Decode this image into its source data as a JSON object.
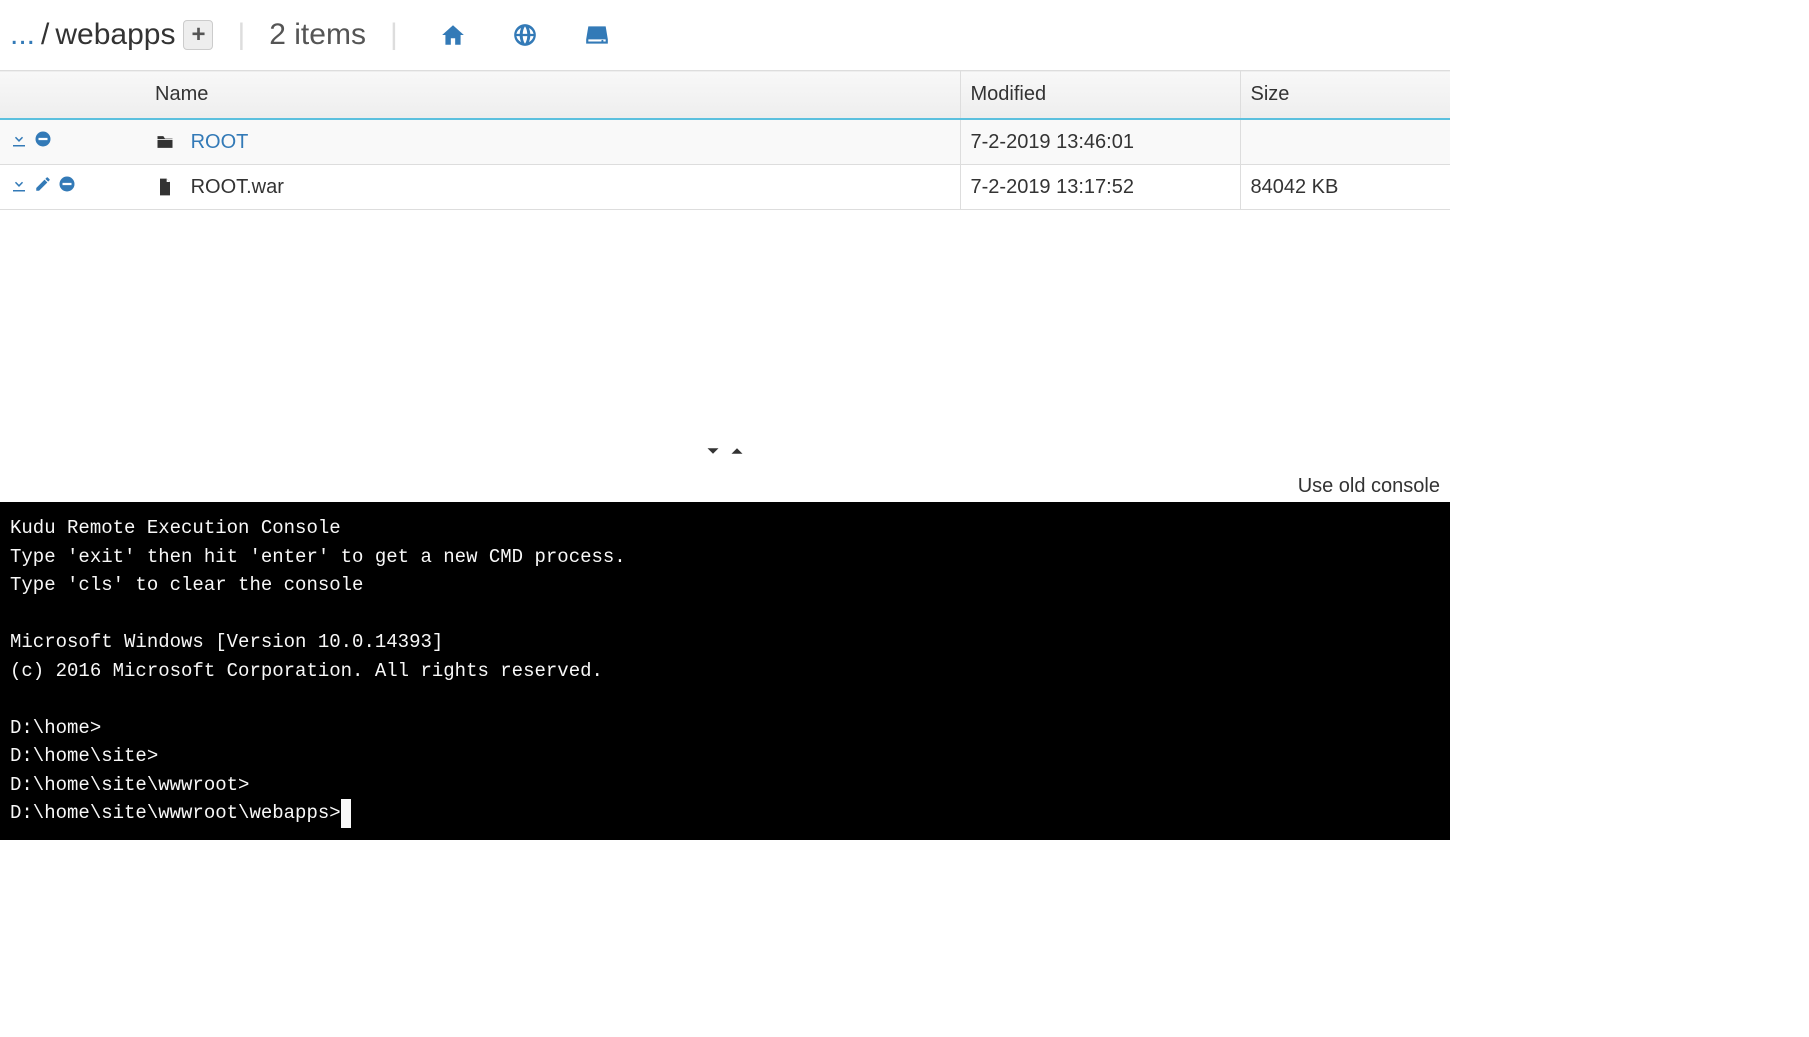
{
  "breadcrumb": {
    "ellipsis": "...",
    "separator": "/",
    "current": "webapps",
    "plus": "+"
  },
  "header": {
    "item_count": "2 items"
  },
  "table": {
    "headers": {
      "name": "Name",
      "modified": "Modified",
      "size": "Size"
    },
    "rows": [
      {
        "type": "folder",
        "name": "ROOT",
        "modified": "7-2-2019 13:46:01",
        "size": ""
      },
      {
        "type": "file",
        "name": "ROOT.war",
        "modified": "7-2-2019 13:17:52",
        "size": "84042 KB"
      }
    ]
  },
  "console_link": "Use old console",
  "console": {
    "lines": [
      "Kudu Remote Execution Console",
      "Type 'exit' then hit 'enter' to get a new CMD process.",
      "Type 'cls' to clear the console",
      "",
      "Microsoft Windows [Version 10.0.14393]",
      "(c) 2016 Microsoft Corporation. All rights reserved.",
      "",
      "D:\\home>",
      "D:\\home\\site>",
      "D:\\home\\site\\wwwroot>"
    ],
    "prompt": "D:\\home\\site\\wwwroot\\webapps>"
  }
}
